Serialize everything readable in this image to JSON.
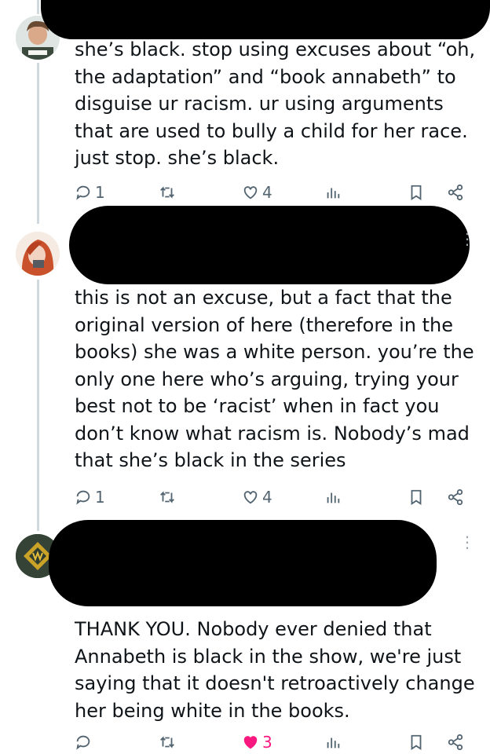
{
  "colors": {
    "text": "#0f1419",
    "muted": "#536471",
    "like": "#f91880",
    "thread": "#cfd9de"
  },
  "replies": [
    {
      "text": "she’s black. stop using excuses about “oh, the adaptation” and “book annabeth” to disguise ur racism. ur using arguments that are used to bully a child for her race. just stop. she’s black.",
      "reply_count": "1",
      "like_count": "4",
      "liked": false
    },
    {
      "text": "this is not an excuse, but a fact that the original version of here (therefore in the books) she was a white person. you’re the only one here who’s arguing, trying your best not to be ‘racist’ when in fact you don’t know what racism is. Nobody’s mad that she’s black in the series",
      "reply_count": "1",
      "like_count": "4",
      "liked": false
    },
    {
      "text": "THANK YOU. Nobody ever denied that Annabeth is black in the show, we're just saying that it doesn't retroactively change her being white in the books.",
      "reply_count": "",
      "like_count": "3",
      "liked": true
    }
  ],
  "icons": {
    "reply": "reply-icon",
    "repost": "repost-icon",
    "like": "heart-icon",
    "views": "views-icon",
    "bookmark": "bookmark-icon",
    "share": "share-icon",
    "more": "more-icon"
  }
}
